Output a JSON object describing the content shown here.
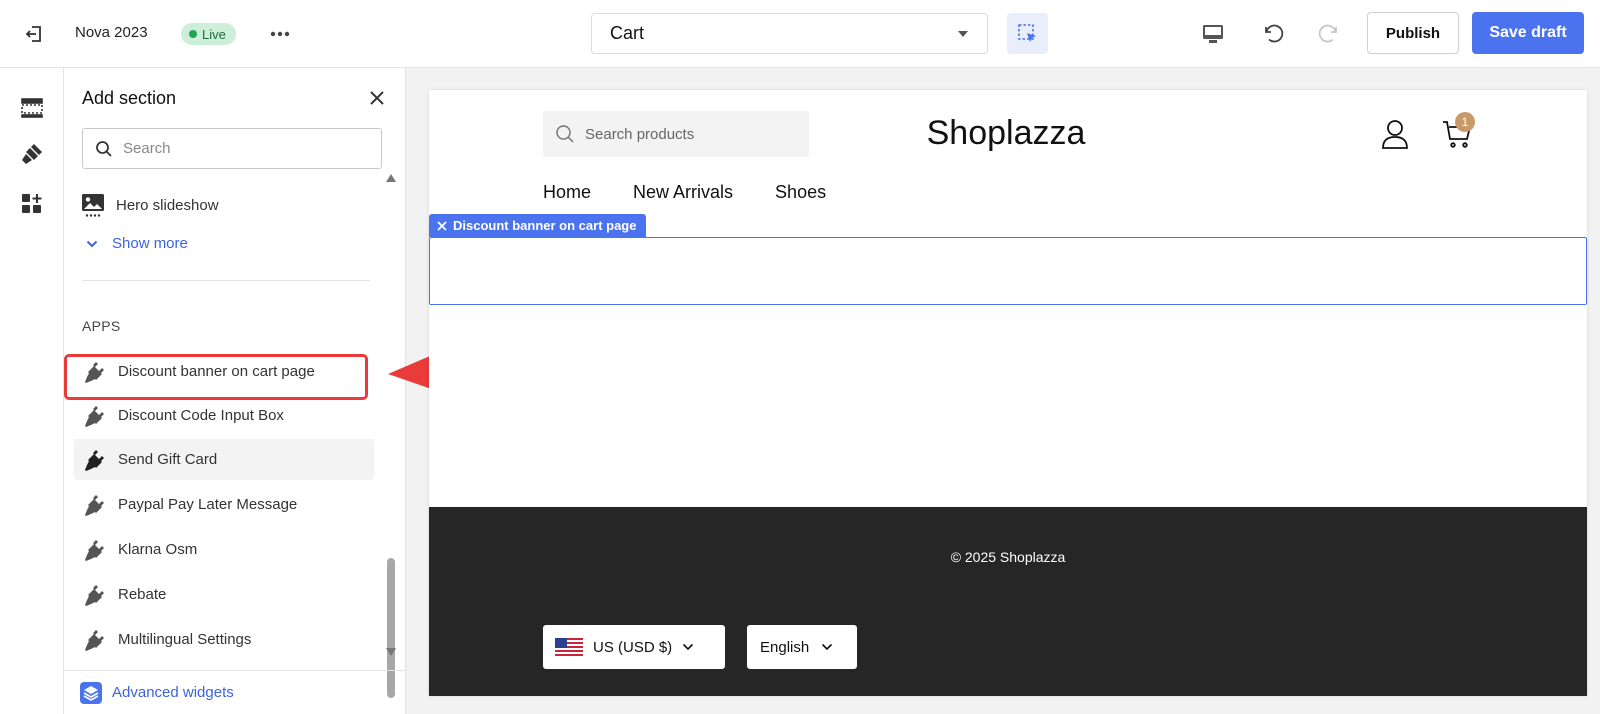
{
  "topbar": {
    "store_name": "Nova 2023",
    "live_label": "Live",
    "page_selector": "Cart",
    "publish_label": "Publish",
    "save_draft_label": "Save draft"
  },
  "panel": {
    "title": "Add section",
    "search_placeholder": "Search",
    "items_top": [
      {
        "label": "Hero slideshow",
        "icon": "image-icon"
      }
    ],
    "show_more_label": "Show more",
    "apps_heading": "APPS",
    "apps": [
      {
        "label": "Discount banner on cart page"
      },
      {
        "label": "Discount Code Input Box"
      },
      {
        "label": "Send Gift Card"
      },
      {
        "label": "Paypal Pay Later Message"
      },
      {
        "label": "Klarna Osm"
      },
      {
        "label": "Rebate"
      },
      {
        "label": "Multilingual Settings"
      }
    ],
    "footer_label": "Advanced widgets"
  },
  "preview": {
    "search_placeholder": "Search products",
    "logo": "Shoplazza",
    "cart_count": "1",
    "nav": [
      "Home",
      "New Arrivals",
      "Shoes"
    ],
    "section_tag": "Discount banner on cart page",
    "copyright": "© 2025 Shoplazza",
    "currency": "US  (USD $)",
    "language": "English"
  },
  "colors": {
    "accent": "#4b73ef",
    "link": "#3d63dd",
    "live_bg": "#cdeed9",
    "live_dot": "#23a356",
    "highlight": "#ea3b3b",
    "footer_bg": "#262626",
    "cart_badge": "#c89a6a"
  }
}
